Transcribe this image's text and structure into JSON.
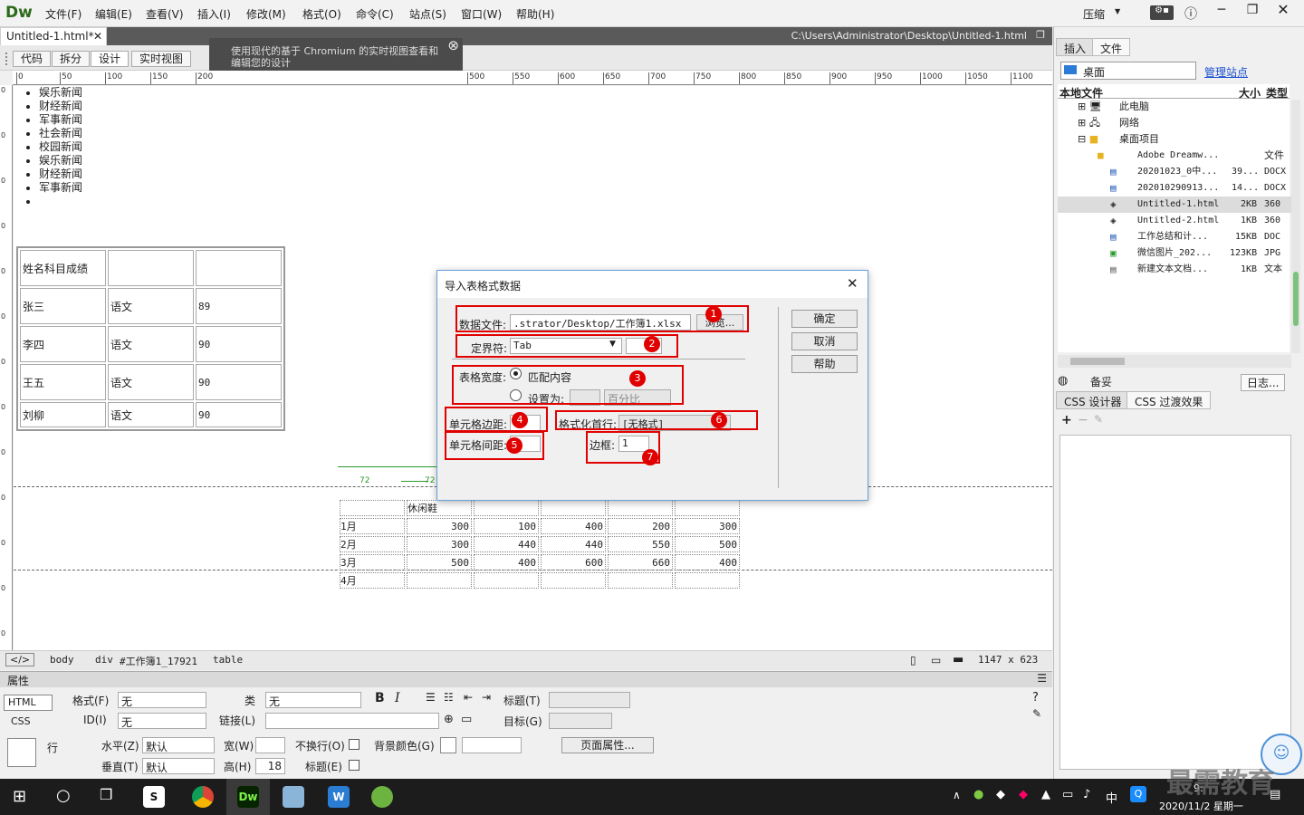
{
  "app": {
    "logo": "Dw",
    "search_label": "压缩"
  },
  "menu": [
    "文件(F)",
    "编辑(E)",
    "查看(V)",
    "插入(I)",
    "修改(M)",
    "格式(O)",
    "命令(C)",
    "站点(S)",
    "窗口(W)",
    "帮助(H)"
  ],
  "doc": {
    "tab": "Untitled-1.html*",
    "path": "C:\\Users\\Administrator\\Desktop\\Untitled-1.html"
  },
  "views": [
    "代码",
    "拆分",
    "设计",
    "实时视图"
  ],
  "tip": "使用现代的基于 Chromium 的实时视图查看和编辑您的设计",
  "ruler": [
    "0",
    "50",
    "100",
    "150",
    "200",
    "500",
    "550",
    "600",
    "650",
    "700",
    "750",
    "800",
    "850",
    "900",
    "950",
    "1000",
    "1050",
    "1100"
  ],
  "news": [
    "娱乐新闻",
    "财经新闻",
    "军事新闻",
    "社会新闻",
    "校园新闻",
    "娱乐新闻",
    "财经新闻",
    "军事新闻",
    ""
  ],
  "table1": [
    [
      "姓名科目成绩",
      "",
      ""
    ],
    [
      "张三",
      "语文",
      "89"
    ],
    [
      "李四",
      "语文",
      "90"
    ],
    [
      "王五",
      "语文",
      "90"
    ],
    [
      "刘柳",
      "语文",
      "90"
    ]
  ],
  "table2": {
    "width_labels": [
      "72",
      "72"
    ],
    "header": [
      "",
      "休闲鞋",
      "",
      "",
      "",
      ""
    ],
    "rows": [
      [
        "1月",
        "300",
        "100",
        "400",
        "200",
        "300"
      ],
      [
        "2月",
        "300",
        "440",
        "440",
        "550",
        "500"
      ],
      [
        "3月",
        "500",
        "400",
        "600",
        "660",
        "400"
      ],
      [
        "4月",
        "",
        "",
        "",
        "",
        ""
      ]
    ]
  },
  "status": {
    "tags": [
      "body",
      "div",
      "#工作簿1_17921",
      "table"
    ],
    "size": "1147 x 623"
  },
  "properties": {
    "title": "属性",
    "html_btn": "HTML",
    "css_btn": "CSS",
    "format_label": "格式(F)",
    "format_value": "无",
    "class_label": "类",
    "class_value": "无",
    "id_label": "ID(I)",
    "id_value": "无",
    "link_label": "链接(L)",
    "heading_label": "标题(T)",
    "target_label": "目标(G)",
    "row_label": "行",
    "halign_label": "水平(Z)",
    "halign_value": "默认",
    "valign_label": "垂直(T)",
    "valign_value": "默认",
    "width_label": "宽(W)",
    "height_label": "高(H)",
    "height_value": "18",
    "nowrap_label": "不换行(O)",
    "header_label": "标题(E)",
    "bgcolor_label": "背景颜色(G)",
    "page_props": "页面属性..."
  },
  "dialog": {
    "title": "导入表格式数据",
    "file_label": "数据文件:",
    "file_value": ".strator/Desktop/工作簿1.xlsx",
    "browse": "浏览...",
    "delim_label": "定界符:",
    "delim_value": "Tab",
    "width_label": "表格宽度:",
    "fit": "匹配内容",
    "setto": "设置为:",
    "percent": "百分比",
    "padding_label": "单元格边距:",
    "spacing_label": "单元格间距:",
    "format_label": "格式化首行:",
    "format_value": "[无格式]",
    "border_label": "边框:",
    "border_value": "1",
    "ok": "确定",
    "cancel": "取消",
    "help": "帮助",
    "badges": [
      "1",
      "2",
      "3",
      "4",
      "5",
      "6",
      "7"
    ],
    "highlight_color": "#e00000"
  },
  "right_panel": {
    "tabs": [
      "插入",
      "文件"
    ],
    "site_select": "桌面",
    "manage": "管理站点",
    "columns": [
      "本地文件",
      "大小",
      "类型"
    ],
    "tree": [
      {
        "name": "此电脑",
        "size": "",
        "type": ""
      },
      {
        "name": "网络",
        "size": "",
        "type": ""
      },
      {
        "name": "桌面项目",
        "size": "",
        "type": ""
      },
      {
        "name": "Adobe Dreamw...",
        "size": "",
        "type": "文件"
      },
      {
        "name": "20201023_0中...",
        "size": "39...",
        "type": "DOCX"
      },
      {
        "name": "202010290913...",
        "size": "14...",
        "type": "DOCX"
      },
      {
        "name": "Untitled-1.html",
        "size": "2KB",
        "type": "360"
      },
      {
        "name": "Untitled-2.html",
        "size": "1KB",
        "type": "360"
      },
      {
        "name": "工作总结和计...",
        "size": "15KB",
        "type": "DOC"
      },
      {
        "name": "微信图片_202...",
        "size": "123KB",
        "type": "JPG"
      },
      {
        "name": "新建文本文档...",
        "size": "1KB",
        "type": "文本"
      }
    ],
    "backup": "备妥",
    "log": "日志...",
    "css_tabs": [
      "CSS 设计器",
      "CSS 过渡效果"
    ]
  },
  "taskbar": {
    "time": "9:",
    "date": "2020/11/2 星期一",
    "ime": "中",
    "watermark": "最需教育"
  }
}
